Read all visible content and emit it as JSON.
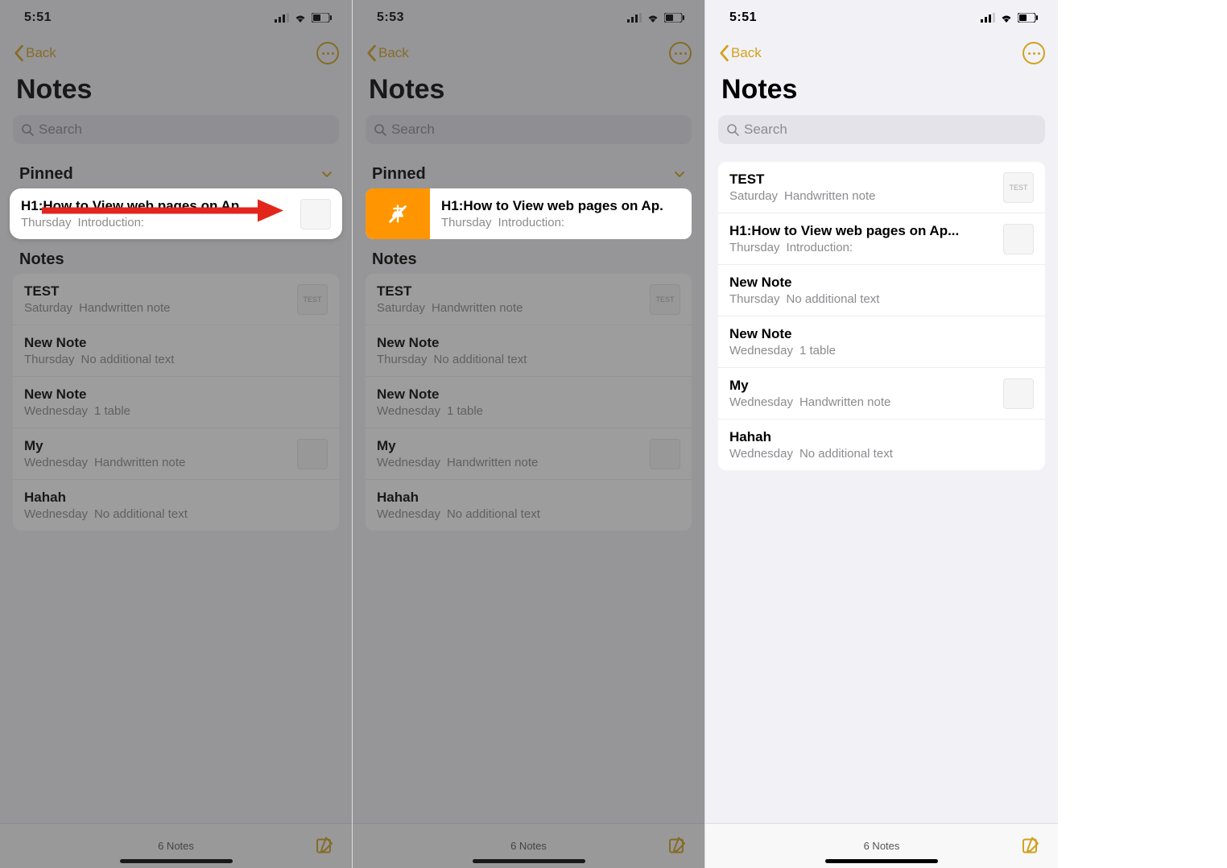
{
  "status": {
    "time_a": "5:51",
    "time_b": "5:53",
    "time_c": "5:51"
  },
  "nav": {
    "back": "Back"
  },
  "header": {
    "title": "Notes"
  },
  "search": {
    "placeholder": "Search"
  },
  "sections": {
    "pinned": "Pinned",
    "notes": "Notes"
  },
  "pinned_note": {
    "title_short": "H1:How to View web pages on Ap",
    "title_mid": "H1:How to View web pages on Ap.",
    "title_long": "H1:How to View web pages on Ap...",
    "day": "Thursday",
    "preview": "Introduction:"
  },
  "notes": [
    {
      "title": "TEST",
      "day": "Saturday",
      "preview": "Handwritten note",
      "thumb": "TEST"
    },
    {
      "title": "New Note",
      "day": "Thursday",
      "preview": "No additional text",
      "thumb": ""
    },
    {
      "title": "New Note",
      "day": "Wednesday",
      "preview": "1 table",
      "thumb": ""
    },
    {
      "title": "My",
      "day": "Wednesday",
      "preview": "Handwritten note",
      "thumb": " "
    },
    {
      "title": "Hahah",
      "day": "Wednesday",
      "preview": "No additional text",
      "thumb": ""
    }
  ],
  "panel3_notes": [
    {
      "title": "TEST",
      "day": "Saturday",
      "preview": "Handwritten note",
      "thumb": "TEST"
    },
    {
      "title": "H1:How to View web pages on Ap...",
      "day": "Thursday",
      "preview": "Introduction:",
      "thumb": " "
    },
    {
      "title": "New Note",
      "day": "Thursday",
      "preview": "No additional text",
      "thumb": ""
    },
    {
      "title": "New Note",
      "day": "Wednesday",
      "preview": "1 table",
      "thumb": ""
    },
    {
      "title": "My",
      "day": "Wednesday",
      "preview": "Handwritten note",
      "thumb": " "
    },
    {
      "title": "Hahah",
      "day": "Wednesday",
      "preview": "No additional text",
      "thumb": ""
    }
  ],
  "footer": {
    "count": "6 Notes"
  }
}
